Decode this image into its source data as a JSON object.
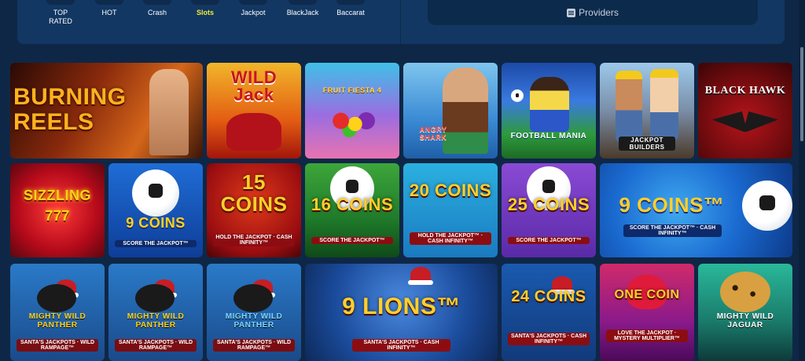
{
  "categories": [
    {
      "label": "TOP\nRATED",
      "active": false
    },
    {
      "label": "HOT",
      "active": false
    },
    {
      "label": "Crash",
      "active": false
    },
    {
      "label": "Slots",
      "active": true
    },
    {
      "label": "Jackpot",
      "active": false
    },
    {
      "label": "BlackJack",
      "active": false
    },
    {
      "label": "Baccarat",
      "active": false
    }
  ],
  "providers": {
    "label": "Providers",
    "icon": "list-icon"
  },
  "colors": {
    "accent": "#f2ea3a",
    "background": "#0f2746",
    "bar": "#123763"
  },
  "games": [
    {
      "title": "BURNING REELS",
      "sub": ""
    },
    {
      "title": "WILD Jack",
      "sub": ""
    },
    {
      "title": "FRUIT FIESTA 4",
      "sub": ""
    },
    {
      "title": "ANGRY SHARK",
      "sub": ""
    },
    {
      "title": "FOOTBALL MANIA",
      "sub": ""
    },
    {
      "title": "JACKPOT BUILDERS",
      "sub": ""
    },
    {
      "title": "BLACK HAWK",
      "sub": ""
    },
    {
      "title": "SIZZLING 777",
      "sub": ""
    },
    {
      "title": "9 COINS",
      "sub": "SCORE THE JACKPOT™"
    },
    {
      "title": "15 COINS",
      "sub": "HOLD THE JACKPOT · CASH INFINITY™"
    },
    {
      "title": "16 COINS",
      "sub": "SCORE THE JACKPOT™"
    },
    {
      "title": "20 COINS",
      "sub": "HOLD THE JACKPOT™ · CASH INFINITY™"
    },
    {
      "title": "25 COINS",
      "sub": "SCORE THE JACKPOT™"
    },
    {
      "title": "9 COINS™",
      "sub": "SCORE THE JACKPOT™ · CASH INFINITY™"
    },
    {
      "title": "MIGHTY WILD PANTHER",
      "sub": "SANTA'S JACKPOTS · WILD RAMPAGE™"
    },
    {
      "title": "MIGHTY WILD PANTHER",
      "sub": "SANTA'S JACKPOTS · WILD RAMPAGE™"
    },
    {
      "title": "MIGHTY WILD PANTHER",
      "sub": "SANTA'S JACKPOTS · WILD RAMPAGE™"
    },
    {
      "title": "9 LIONS™",
      "sub": "SANTA'S JACKPOTS · CASH INFINITY™"
    },
    {
      "title": "24 COINS",
      "sub": "SANTA'S JACKPOTS · CASH INFINITY™"
    },
    {
      "title": "ONE COIN",
      "sub": "LOVE THE JACKPOT · MYSTERY MULTIPLIER™"
    },
    {
      "title": "MIGHTY WILD JAGUAR",
      "sub": ""
    }
  ]
}
